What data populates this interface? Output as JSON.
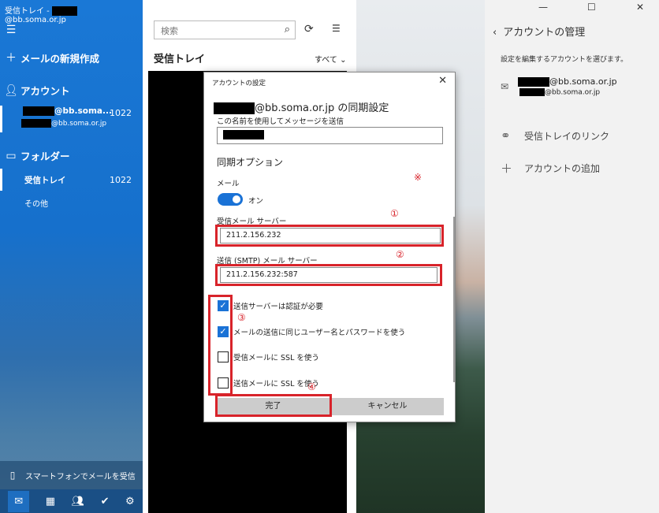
{
  "window": {
    "title_prefix": "受信トレイ - ",
    "title_domain": "@bb.soma.or.jp",
    "controls": [
      "—",
      "☐",
      "✕"
    ]
  },
  "sidebar": {
    "menu_icon": "hamburger-icon",
    "new_mail": "メールの新規作成",
    "accounts_heading": "アカウント",
    "account_short": "@bb.soma...",
    "account_count": "1022",
    "account_email_domain": "@bb.soma.or.jp",
    "folders_heading": "フォルダー",
    "inbox": "受信トレイ",
    "inbox_count": "1022",
    "other": "その他",
    "phone_link": "スマートフォンでメールを受信"
  },
  "list": {
    "search_placeholder": "検索",
    "title": "受信トレイ",
    "filter": "すべて"
  },
  "right_panel": {
    "title": "アカウントの管理",
    "description": "設定を編集するアカウントを選びます。",
    "account_domain": "@bb.soma.or.jp",
    "account_sub_domain": "@bb.soma.or.jp",
    "link_inbox": "受信トレイのリンク",
    "add_account": "アカウントの追加"
  },
  "dialog": {
    "header": "アカウントの設定",
    "title_suffix": "@bb.soma.or.jp の同期設定",
    "send_name_label": "この名前を使用してメッセージを送信",
    "sync_options": "同期オプション",
    "mail_label": "メール",
    "toggle_state": "オン",
    "incoming_label": "受信メール サーバー",
    "incoming_value": "211.2.156.232",
    "outgoing_label": "送信 (SMTP) メール サーバー",
    "outgoing_value": "211.2.156.232:587",
    "checkboxes": [
      {
        "label": "送信サーバーは認証が必要",
        "checked": true
      },
      {
        "label": "メールの送信に同じユーザー名とパスワードを使う",
        "checked": true
      },
      {
        "label": "受信メールに SSL を使う",
        "checked": false
      },
      {
        "label": "送信メールに SSL を使う",
        "checked": false
      }
    ],
    "done_button": "完了",
    "cancel_button": "キャンセル"
  },
  "annotations": {
    "note": "※",
    "n1": "①",
    "n2": "②",
    "n3": "③",
    "n4": "④"
  },
  "colors": {
    "accent": "#1a72d6",
    "highlight_red": "#d8232a"
  }
}
